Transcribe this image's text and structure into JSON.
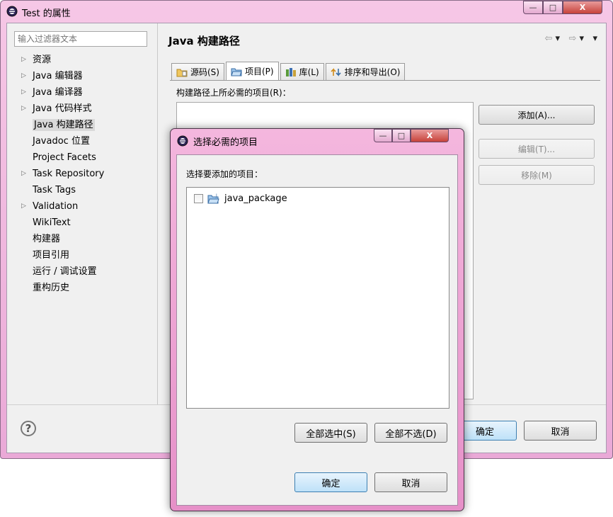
{
  "main_window": {
    "title": "Test 的属性",
    "caption_buttons": {
      "minimize": "—",
      "maximize": "□",
      "close": "X"
    }
  },
  "sidebar": {
    "filter_placeholder": "输入过滤器文本",
    "items": [
      {
        "label": "资源",
        "expandable": true
      },
      {
        "label": "Java 编辑器",
        "expandable": true
      },
      {
        "label": "Java 编译器",
        "expandable": true
      },
      {
        "label": "Java 代码样式",
        "expandable": true
      },
      {
        "label": "Java 构建路径",
        "expandable": false,
        "selected": true
      },
      {
        "label": "Javadoc 位置",
        "expandable": false
      },
      {
        "label": "Project Facets",
        "expandable": false
      },
      {
        "label": "Task Repository",
        "expandable": true
      },
      {
        "label": "Task Tags",
        "expandable": false
      },
      {
        "label": "Validation",
        "expandable": true
      },
      {
        "label": "WikiText",
        "expandable": false
      },
      {
        "label": "构建器",
        "expandable": false
      },
      {
        "label": "项目引用",
        "expandable": false
      },
      {
        "label": "运行 / 调试设置",
        "expandable": false
      },
      {
        "label": "重构历史",
        "expandable": false
      }
    ]
  },
  "page": {
    "title": "Java 构建路径",
    "nav": {
      "back": "⇦",
      "forward": "⇨",
      "menu": "▾"
    },
    "tabs": [
      {
        "label": "源码(S)",
        "icon": "source-folder-icon"
      },
      {
        "label": "项目(P)",
        "icon": "project-folder-icon",
        "active": true
      },
      {
        "label": "库(L)",
        "icon": "library-icon"
      },
      {
        "label": "排序和导出(O)",
        "icon": "order-export-icon"
      }
    ],
    "section_label": "构建路径上所必需的项目(R)：",
    "buttons": {
      "add": "添加(A)...",
      "edit": "编辑(T)...",
      "remove": "移除(M)"
    }
  },
  "footer": {
    "help": "?",
    "ok": "确定",
    "cancel": "取消"
  },
  "dialog": {
    "title": "选择必需的项目",
    "label": "选择要添加的项目：",
    "projects": [
      {
        "name": "java_package",
        "checked": false
      }
    ],
    "select_all": "全部选中(S)",
    "deselect_all": "全部不选(D)",
    "ok": "确定",
    "cancel": "取消",
    "caption_buttons": {
      "minimize": "—",
      "maximize": "□",
      "close": "X"
    }
  }
}
